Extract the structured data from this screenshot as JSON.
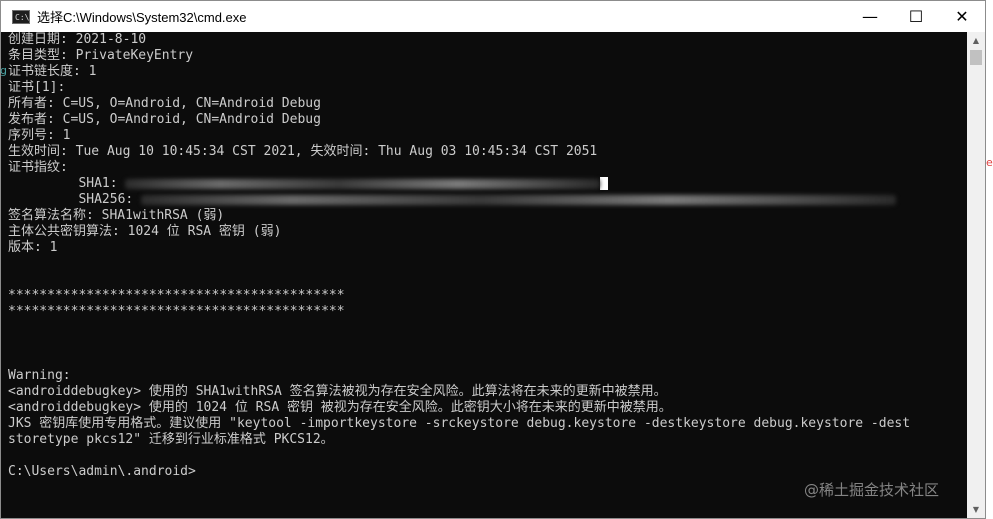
{
  "window": {
    "title": "选择C:\\Windows\\System32\\cmd.exe",
    "app_icon_text": "C:\\",
    "minimize": "—",
    "maximize": "☐",
    "close": "✕"
  },
  "console": {
    "lines": [
      "创建日期: 2021-8-10",
      "条目类型: PrivateKeyEntry",
      "证书链长度: 1",
      "证书[1]:",
      "所有者: C=US, O=Android, CN=Android Debug",
      "发布者: C=US, O=Android, CN=Android Debug",
      "序列号: 1",
      "生效时间: Tue Aug 10 10:45:34 CST 2021, 失效时间: Thu Aug 03 10:45:34 CST 2051",
      "证书指纹:",
      "         SHA1: ",
      "         SHA256: ",
      "签名算法名称: SHA1withRSA (弱)",
      "主体公共密钥算法: 1024 位 RSA 密钥 (弱)",
      "版本: 1",
      "",
      "",
      "*******************************************",
      "*******************************************",
      "",
      "",
      "",
      "Warning:",
      "<androiddebugkey> 使用的 SHA1withRSA 签名算法被视为存在安全风险。此算法将在未来的更新中被禁用。",
      "<androiddebugkey> 使用的 1024 位 RSA 密钥 被视为存在安全风险。此密钥大小将在未来的更新中被禁用。",
      "JKS 密钥库使用专用格式。建议使用 \"keytool -importkeystore -srckeystore debug.keystore -destkeystore debug.keystore -dest",
      "storetype pkcs12\" 迁移到行业标准格式 PKCS12。",
      "",
      "C:\\Users\\admin\\.android>"
    ]
  },
  "watermark": "@稀土掘金技术社区",
  "side_marks": {
    "left": "g",
    "right": "e"
  },
  "colors": {
    "console_bg": "#0c0c0c",
    "console_text": "#cccccc",
    "titlebar_bg": "#ffffff"
  }
}
